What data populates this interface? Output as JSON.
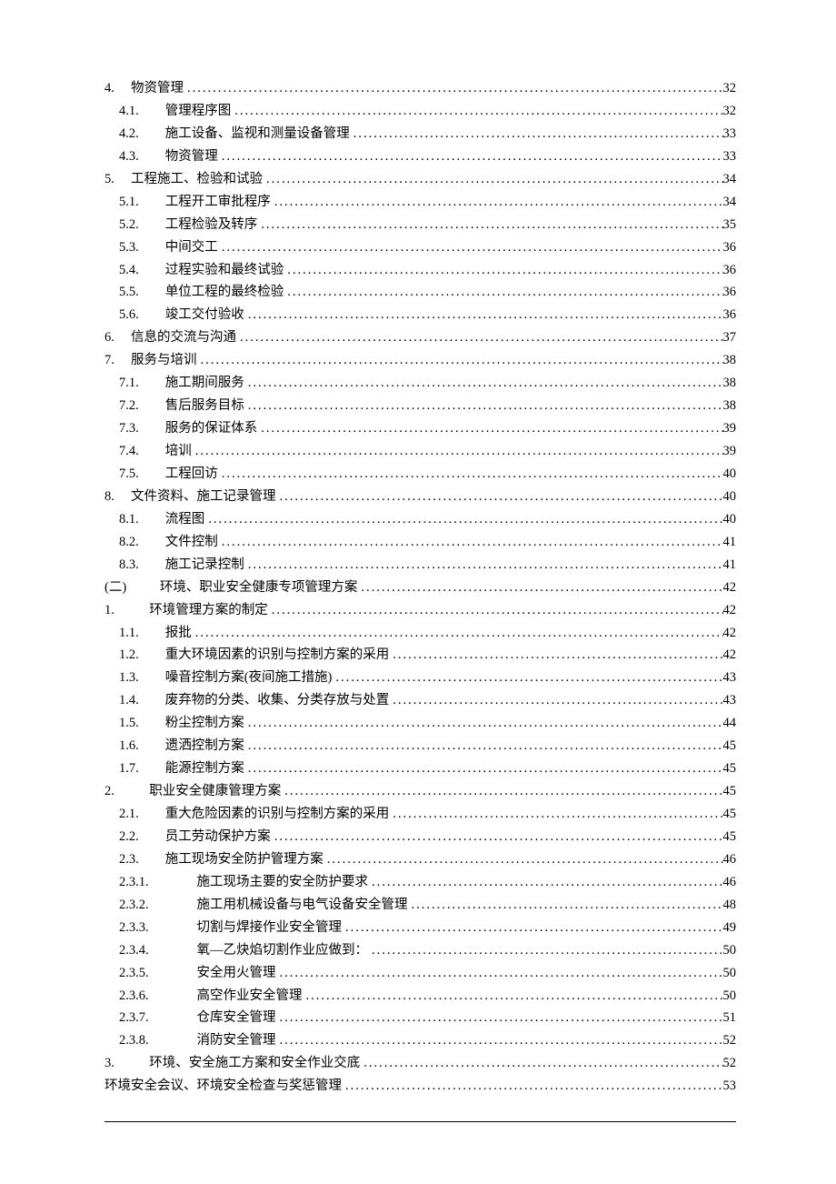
{
  "toc": [
    {
      "indent": 0,
      "num": "4.",
      "title": "物资管理",
      "page": "32",
      "numWidth": "2.0em",
      "gap": "0"
    },
    {
      "indent": 1,
      "num": "4.1.",
      "title": "管理程序图",
      "page": "32",
      "numWidth": "3.2em",
      "gap": "0.3em"
    },
    {
      "indent": 1,
      "num": "4.2.",
      "title": "施工设备、监视和测量设备管理",
      "page": "33",
      "numWidth": "3.2em",
      "gap": "0.3em"
    },
    {
      "indent": 1,
      "num": "4.3.",
      "title": "物资管理",
      "page": "33",
      "numWidth": "3.2em",
      "gap": "0.3em"
    },
    {
      "indent": 0,
      "num": "5.",
      "title": "工程施工、检验和试验",
      "page": "34",
      "numWidth": "2.0em",
      "gap": "0"
    },
    {
      "indent": 1,
      "num": "5.1.",
      "title": "工程开工审批程序",
      "page": "34",
      "numWidth": "3.2em",
      "gap": "0.3em"
    },
    {
      "indent": 1,
      "num": "5.2.",
      "title": "工程检验及转序",
      "page": "35",
      "numWidth": "3.2em",
      "gap": "0.3em"
    },
    {
      "indent": 1,
      "num": "5.3.",
      "title": "中间交工",
      "page": "36",
      "numWidth": "3.2em",
      "gap": "0.3em"
    },
    {
      "indent": 1,
      "num": "5.4.",
      "title": "过程实验和最终试验",
      "page": "36",
      "numWidth": "3.2em",
      "gap": "0.3em"
    },
    {
      "indent": 1,
      "num": "5.5.",
      "title": "单位工程的最终检验",
      "page": "36",
      "numWidth": "3.2em",
      "gap": "0.3em"
    },
    {
      "indent": 1,
      "num": "5.6.",
      "title": "竣工交付验收",
      "page": "36",
      "numWidth": "3.2em",
      "gap": "0.3em"
    },
    {
      "indent": 0,
      "num": "6.",
      "title": "信息的交流与沟通",
      "page": "37",
      "numWidth": "2.0em",
      "gap": "0"
    },
    {
      "indent": 0,
      "num": "7.",
      "title": "服务与培训",
      "page": "38",
      "numWidth": "2.0em",
      "gap": "0"
    },
    {
      "indent": 1,
      "num": "7.1.",
      "title": "施工期间服务",
      "page": "38",
      "numWidth": "3.2em",
      "gap": "0.3em"
    },
    {
      "indent": 1,
      "num": "7.2.",
      "title": "售后服务目标",
      "page": "38",
      "numWidth": "3.2em",
      "gap": "0.3em"
    },
    {
      "indent": 1,
      "num": "7.3.",
      "title": "服务的保证体系",
      "page": "39",
      "numWidth": "3.2em",
      "gap": "0.3em"
    },
    {
      "indent": 1,
      "num": "7.4.",
      "title": "培训",
      "page": "39",
      "numWidth": "3.2em",
      "gap": "0.3em"
    },
    {
      "indent": 1,
      "num": "7.5.",
      "title": "工程回访",
      "page": "40",
      "numWidth": "3.2em",
      "gap": "0.3em"
    },
    {
      "indent": 0,
      "num": "8.",
      "title": "文件资料、施工记录管理",
      "page": "40",
      "numWidth": "2.0em",
      "gap": "0"
    },
    {
      "indent": 1,
      "num": "8.1.",
      "title": "流程图",
      "page": "40",
      "numWidth": "3.2em",
      "gap": "0.3em"
    },
    {
      "indent": 1,
      "num": "8.2.",
      "title": "文件控制",
      "page": "41",
      "numWidth": "3.2em",
      "gap": "0.3em"
    },
    {
      "indent": 1,
      "num": "8.3.",
      "title": "施工记录控制",
      "page": "41",
      "numWidth": "3.2em",
      "gap": "0.3em"
    },
    {
      "indent": 0,
      "num": "(二)",
      "title": "环境、职业安全健康专项管理方案",
      "page": "42",
      "numWidth": "4.2em",
      "gap": "0"
    },
    {
      "indent": 0,
      "num": "1.",
      "title": "环境管理方案的制定",
      "page": "42",
      "numWidth": "3.4em",
      "gap": "0"
    },
    {
      "indent": 1,
      "num": "1.1.",
      "title": "报批",
      "page": "42",
      "numWidth": "3.2em",
      "gap": "0.3em"
    },
    {
      "indent": 1,
      "num": "1.2.",
      "title": "重大环境因素的识别与控制方案的采用",
      "page": "42",
      "numWidth": "3.2em",
      "gap": "0.3em"
    },
    {
      "indent": 1,
      "num": "1.3.",
      "title": "噪音控制方案(夜间施工措施)",
      "page": "43",
      "numWidth": "3.2em",
      "gap": "0.3em"
    },
    {
      "indent": 1,
      "num": "1.4.",
      "title": "废弃物的分类、收集、分类存放与处置",
      "page": "43",
      "numWidth": "3.2em",
      "gap": "0.3em"
    },
    {
      "indent": 1,
      "num": "1.5.",
      "title": "粉尘控制方案",
      "page": "44",
      "numWidth": "3.2em",
      "gap": "0.3em"
    },
    {
      "indent": 1,
      "num": "1.6.",
      "title": "遗洒控制方案",
      "page": "45",
      "numWidth": "3.2em",
      "gap": "0.3em"
    },
    {
      "indent": 1,
      "num": "1.7.",
      "title": "能源控制方案",
      "page": "45",
      "numWidth": "3.2em",
      "gap": "0.3em"
    },
    {
      "indent": 0,
      "num": "2.",
      "title": "职业安全健康管理方案",
      "page": "45",
      "numWidth": "3.4em",
      "gap": "0"
    },
    {
      "indent": 1,
      "num": "2.1.",
      "title": "重大危险因素的识别与控制方案的采用",
      "page": "45",
      "numWidth": "3.2em",
      "gap": "0.3em"
    },
    {
      "indent": 1,
      "num": "2.2.",
      "title": "员工劳动保护方案",
      "page": "45",
      "numWidth": "3.2em",
      "gap": "0.3em"
    },
    {
      "indent": 1,
      "num": "2.3.",
      "title": "施工现场安全防护管理方案",
      "page": "46",
      "numWidth": "3.2em",
      "gap": "0.3em"
    },
    {
      "indent": 2,
      "num": "2.3.1.",
      "title": "施工现场主要的安全防护要求",
      "page": "46",
      "numWidth": "5.6em",
      "gap": "0.3em"
    },
    {
      "indent": 2,
      "num": "2.3.2.",
      "title": "施工用机械设备与电气设备安全管理",
      "page": "48",
      "numWidth": "5.6em",
      "gap": "0.3em"
    },
    {
      "indent": 2,
      "num": "2.3.3.",
      "title": "切割与焊接作业安全管理",
      "page": "49",
      "numWidth": "5.6em",
      "gap": "0.3em"
    },
    {
      "indent": 2,
      "num": "2.3.4.",
      "title": "氧—乙炔焰切割作业应做到：",
      "page": "50",
      "numWidth": "5.6em",
      "gap": "0.3em"
    },
    {
      "indent": 2,
      "num": "2.3.5.",
      "title": "安全用火管理",
      "page": "50",
      "numWidth": "5.6em",
      "gap": "0.3em"
    },
    {
      "indent": 2,
      "num": "2.3.6.",
      "title": "高空作业安全管理",
      "page": "50",
      "numWidth": "5.6em",
      "gap": "0.3em"
    },
    {
      "indent": 2,
      "num": "2.3.7.",
      "title": "仓库安全管理",
      "page": "51",
      "numWidth": "5.6em",
      "gap": "0.3em"
    },
    {
      "indent": 2,
      "num": "2.3.8.",
      "title": "消防安全管理",
      "page": "52",
      "numWidth": "5.6em",
      "gap": "0.3em"
    },
    {
      "indent": 0,
      "num": "3.",
      "title": "环境、安全施工方案和安全作业交底",
      "page": "52",
      "numWidth": "3.4em",
      "gap": "0"
    },
    {
      "indent": 0,
      "num": "",
      "title": "环境安全会议、环境安全检查与奖惩管理",
      "page": "53",
      "numWidth": "0",
      "gap": "0"
    }
  ]
}
